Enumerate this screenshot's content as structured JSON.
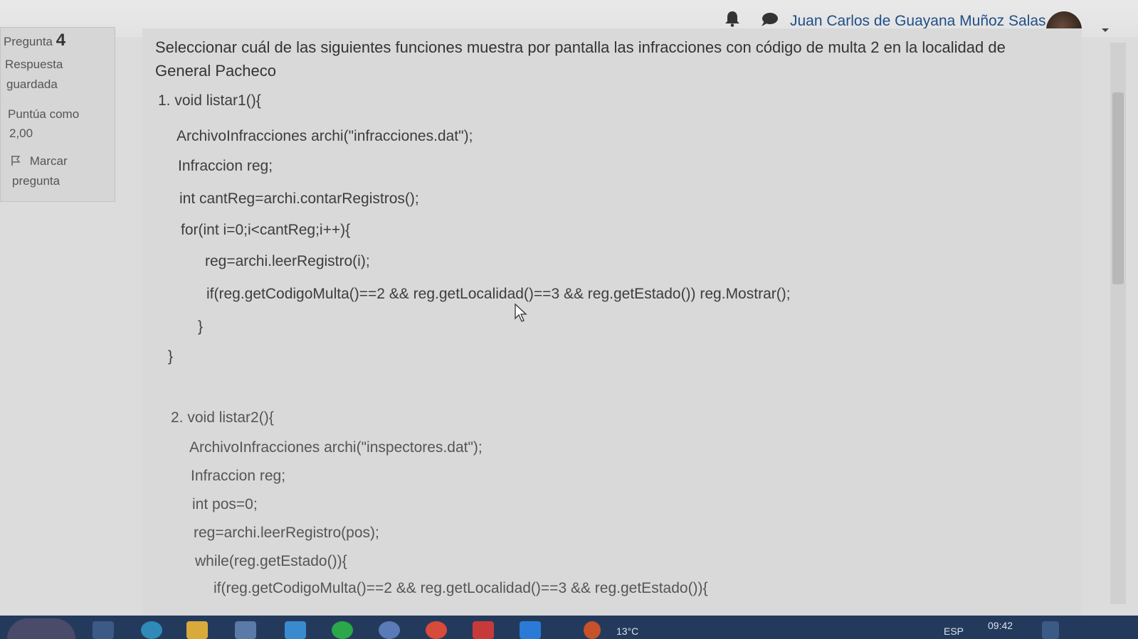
{
  "header": {
    "user_name": "Juan Carlos de Guayana Muñoz Salas",
    "icons": [
      "bell-icon",
      "chat-icon",
      "avatar",
      "chevron-down-icon"
    ]
  },
  "question_info": {
    "label": "Pregunta",
    "number": "4",
    "status_line1": "Respuesta",
    "status_line2": "guardada",
    "score_line1": "Puntúa como",
    "score_line2": "2,00",
    "flag_line1": "Marcar",
    "flag_line2": "pregunta"
  },
  "question": {
    "text": "Seleccionar cuál de las siguientes funciones muestra por pantalla las infracciones con código de multa 2 en la localidad de General Pacheco"
  },
  "option1": {
    "lines": [
      "1. void listar1(){",
      "ArchivoInfracciones archi(\"infracciones.dat\");",
      "Infraccion reg;",
      "int cantReg=archi.contarRegistros();",
      "for(int i=0;i<cantReg;i++){",
      "reg=archi.leerRegistro(i);",
      "if(reg.getCodigoMulta()==2 && reg.getLocalidad()==3 && reg.getEstado()) reg.Mostrar();",
      "}",
      "}"
    ]
  },
  "option2": {
    "lines": [
      "2. void listar2(){",
      "ArchivoInfracciones archi(\"inspectores.dat\");",
      "Infraccion reg;",
      "int pos=0;",
      "reg=archi.leerRegistro(pos);",
      "while(reg.getEstado()){",
      "if(reg.getCodigoMulta()==2 && reg.getLocalidad()==3 && reg.getEstado()){"
    ]
  },
  "taskbar": {
    "temperature": "13°C",
    "language": "ESP",
    "time": "09:42"
  },
  "colors": {
    "link_blue": "#1f4f88",
    "taskbar": "#243a5c",
    "page_background": "#dcdcdc"
  }
}
